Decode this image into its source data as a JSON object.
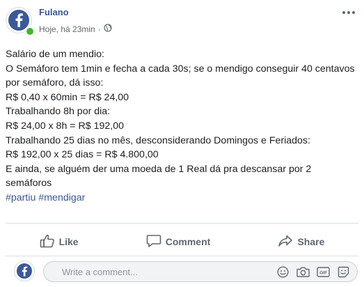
{
  "post": {
    "author": "Fulano",
    "timestamp": "Hoje, há 23min",
    "separator": "·",
    "privacy_icon": "globe-icon",
    "options_icon": "ellipsis-icon",
    "text_lines": [
      "Salário de um mendio:",
      "O Semáforo tem 1min e fecha a cada 30s; se o mendigo conseguir 40 centavos",
      "por semáforo, dá isso:",
      "R$ 0,40 x 60min = R$ 24,00",
      "Trabalhando 8h por dia:",
      "R$ 24,00 x 8h = R$ 192,00",
      "Trabalhando 25 dias no mês, desconsiderando Domingos e Feriados:",
      "R$ 192,00 x 25 dias = R$ 4.800,00",
      "E ainda, se alguém der uma moeda de 1 Real dá pra descansar por 2",
      "semáforos"
    ],
    "hashtags": [
      "#partiu",
      "#mendigar"
    ]
  },
  "actions": {
    "like_label": "Like",
    "comment_label": "Comment",
    "share_label": "Share"
  },
  "comment_bar": {
    "placeholder": "Write a comment...",
    "tools": [
      "emoji-icon",
      "camera-icon",
      "gif-icon",
      "sticker-icon"
    ],
    "gif_label": "GIF"
  },
  "colors": {
    "brand": "#3b5998",
    "link": "#385898",
    "presence": "#42b72a",
    "muted": "#606770"
  }
}
